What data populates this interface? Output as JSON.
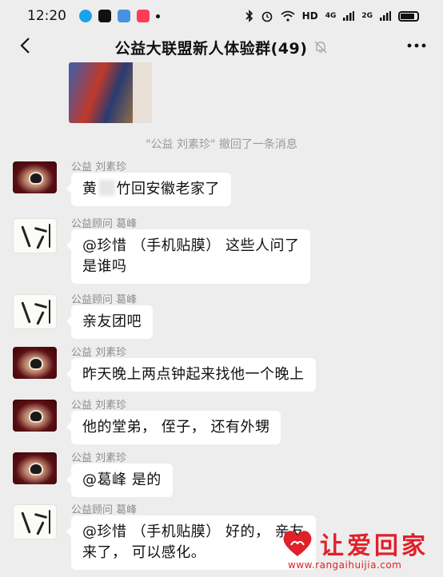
{
  "status_bar": {
    "time": "12:20",
    "hd_label": "HD",
    "signal_a": "4G",
    "signal_b": "2G"
  },
  "header": {
    "back_icon": "chevron-left-icon",
    "title": "公益大联盟新人体验群(49)",
    "mute_icon": "bell-off-icon",
    "more_icon": "more-dots-icon"
  },
  "system": {
    "recall_notice": "\"公益  刘素珍\" 撤回了一条消息"
  },
  "messages": [
    {
      "sender": "公益  刘素珍",
      "text_a": "黄",
      "text_b": "竹回安徽老家了"
    },
    {
      "sender": "公益顾问  葛峰",
      "line1": "@珍惜 （手机贴膜）  这些人问了",
      "line2": "是谁吗"
    },
    {
      "sender": "公益顾问  葛峰",
      "text": "亲友团吧"
    },
    {
      "sender": "公益  刘素珍",
      "text": "昨天晚上两点钟起来找他一个晚上"
    },
    {
      "sender": "公益  刘素珍",
      "text": "他的堂弟， 侄子， 还有外甥"
    },
    {
      "sender": "公益  刘素珍",
      "text": "@葛峰  是的"
    },
    {
      "sender": "公益顾问  葛峰",
      "line1": "@珍惜 （手机贴膜）  好的， 亲友",
      "line2": "来了， 可以感化。"
    }
  ],
  "watermark": {
    "text": "让爱回家",
    "url": "www.rangaihuijia.com"
  },
  "colors": {
    "background": "#ededed",
    "bubble": "#ffffff",
    "watermark_red": "#e0202a"
  }
}
